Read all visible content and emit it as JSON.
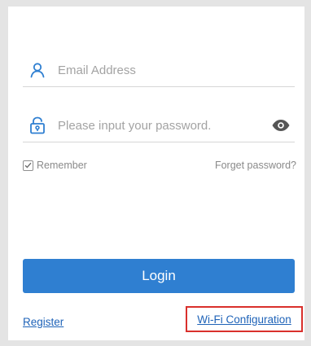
{
  "login_form": {
    "email": {
      "placeholder": "Email Address",
      "value": ""
    },
    "password": {
      "placeholder": "Please input your password.",
      "value": ""
    },
    "remember_label": "Remember",
    "remember_checked": true,
    "forgot_label": "Forget password?",
    "login_label": "Login"
  },
  "footer": {
    "register_label": "Register",
    "wifi_config_label": "Wi-Fi Configuration"
  },
  "icons": {
    "email": "user-icon",
    "password": "lock-icon",
    "toggle_visibility": "eye-icon",
    "checkbox": "check-icon"
  },
  "colors": {
    "accent": "#2f7fd1",
    "link": "#1f63b8",
    "highlight_box": "#d9302c"
  }
}
